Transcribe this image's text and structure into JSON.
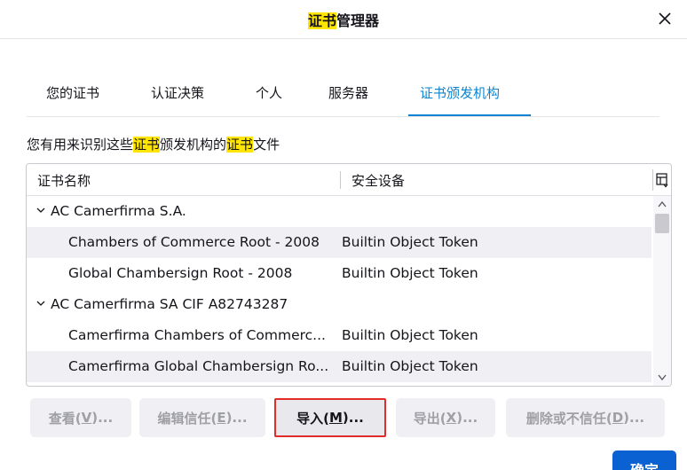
{
  "dialog": {
    "title_highlight": "证书",
    "title_rest": "管理器",
    "close_glyph": "✕"
  },
  "tabs": [
    {
      "label": "您的证书",
      "active": false
    },
    {
      "label": "认证决策",
      "active": false
    },
    {
      "label": "个人",
      "active": false
    },
    {
      "label": "服务器",
      "active": false
    },
    {
      "label": "证书颁发机构",
      "active": true
    }
  ],
  "description": {
    "part1": "您有用来识别这些",
    "hl1": "证书",
    "part2": "颁发机构的",
    "hl2": "证书",
    "part3": "文件"
  },
  "table": {
    "headers": {
      "name": "证书名称",
      "device": "安全设备"
    },
    "rows": [
      {
        "type": "group",
        "name": "AC Camerfirma S.A.",
        "device": ""
      },
      {
        "type": "item",
        "name": "Chambers of Commerce Root - 2008",
        "device": "Builtin Object Token"
      },
      {
        "type": "item",
        "name": "Global Chambersign Root - 2008",
        "device": "Builtin Object Token"
      },
      {
        "type": "group",
        "name": "AC Camerfirma SA CIF A82743287",
        "device": ""
      },
      {
        "type": "item",
        "name": "Camerfirma Chambers of Commerc...",
        "device": "Builtin Object Token"
      },
      {
        "type": "item",
        "name": "Camerfirma Global Chambersign Ro...",
        "device": "Builtin Object Token"
      }
    ]
  },
  "buttons": {
    "view": {
      "label": "查看(",
      "key": "V",
      "suffix": ")..."
    },
    "edit_trust": {
      "label": "编辑信任(",
      "key": "E",
      "suffix": ")..."
    },
    "import": {
      "label": "导入(",
      "key": "M",
      "suffix": ")..."
    },
    "export": {
      "label": "导出(",
      "key": "X",
      "suffix": ")..."
    },
    "delete": {
      "label": "删除或不信任(",
      "key": "D",
      "suffix": ")..."
    },
    "ok": "确定"
  },
  "colors": {
    "accent": "#0a84d0",
    "highlight": "#ffe500",
    "import_outline": "#e22b2b",
    "ok_button": "#0a61d1"
  }
}
